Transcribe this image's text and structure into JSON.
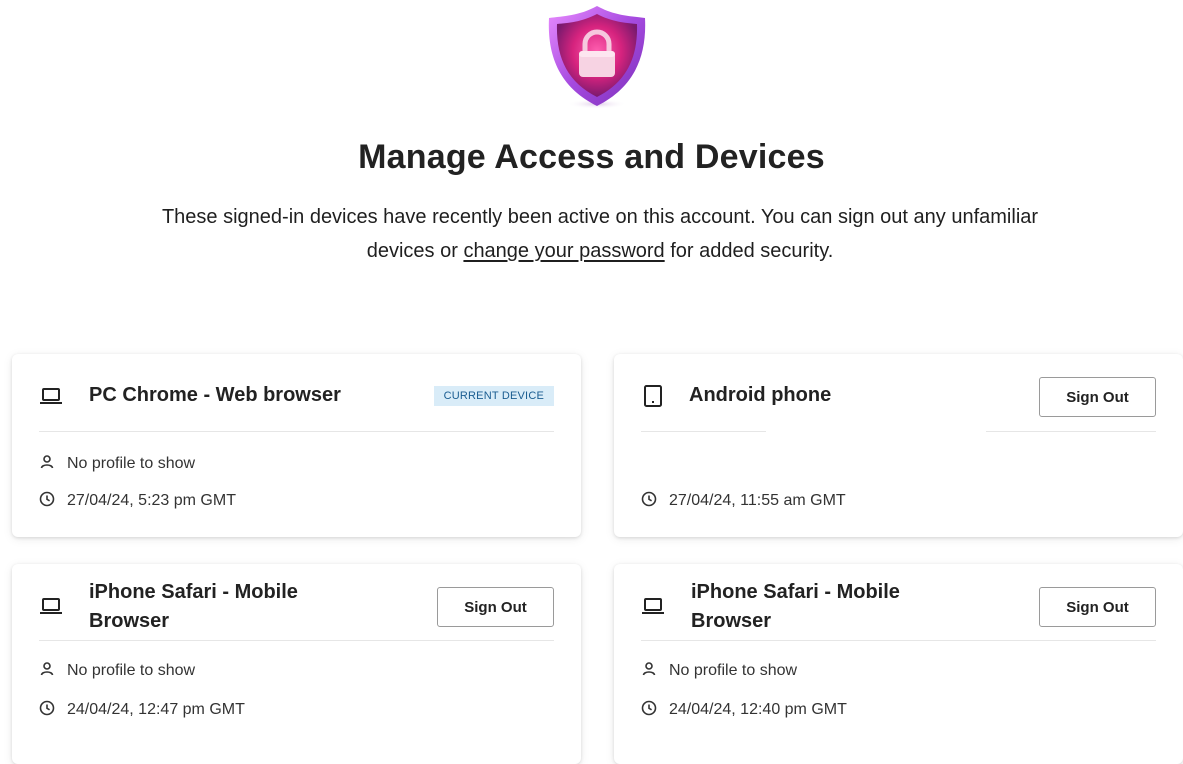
{
  "hero": {
    "title": "Manage Access and Devices",
    "desc_before": "These signed-in devices have recently been active on this account. You can sign out any unfamiliar devices or ",
    "desc_link": "change your password",
    "desc_after": " for added security.",
    "shield_icon": "shield-lock-icon"
  },
  "devices": [
    {
      "name": "PC Chrome - Web browser",
      "icon": "laptop-icon",
      "badge": "CURRENT DEVICE",
      "profile": "No profile to show",
      "timestamp": "27/04/24, 5:23 pm GMT"
    },
    {
      "name": "Android phone",
      "icon": "tablet-icon",
      "signout_label": "Sign Out",
      "timestamp": "27/04/24, 11:55 am GMT"
    },
    {
      "name": "iPhone Safari - Mobile Browser",
      "icon": "laptop-icon",
      "signout_label": "Sign Out",
      "profile": "No profile to show",
      "timestamp": "24/04/24, 12:47 pm GMT"
    },
    {
      "name": "iPhone Safari - Mobile Browser",
      "icon": "laptop-icon",
      "signout_label": "Sign Out",
      "profile": "No profile to show",
      "timestamp": "24/04/24, 12:40 pm GMT"
    }
  ],
  "colors": {
    "badge_bg": "#d9ecf8",
    "badge_text": "#1a5d91",
    "shield_pink": "#e0218a",
    "shield_purple": "#9b3fd6"
  }
}
